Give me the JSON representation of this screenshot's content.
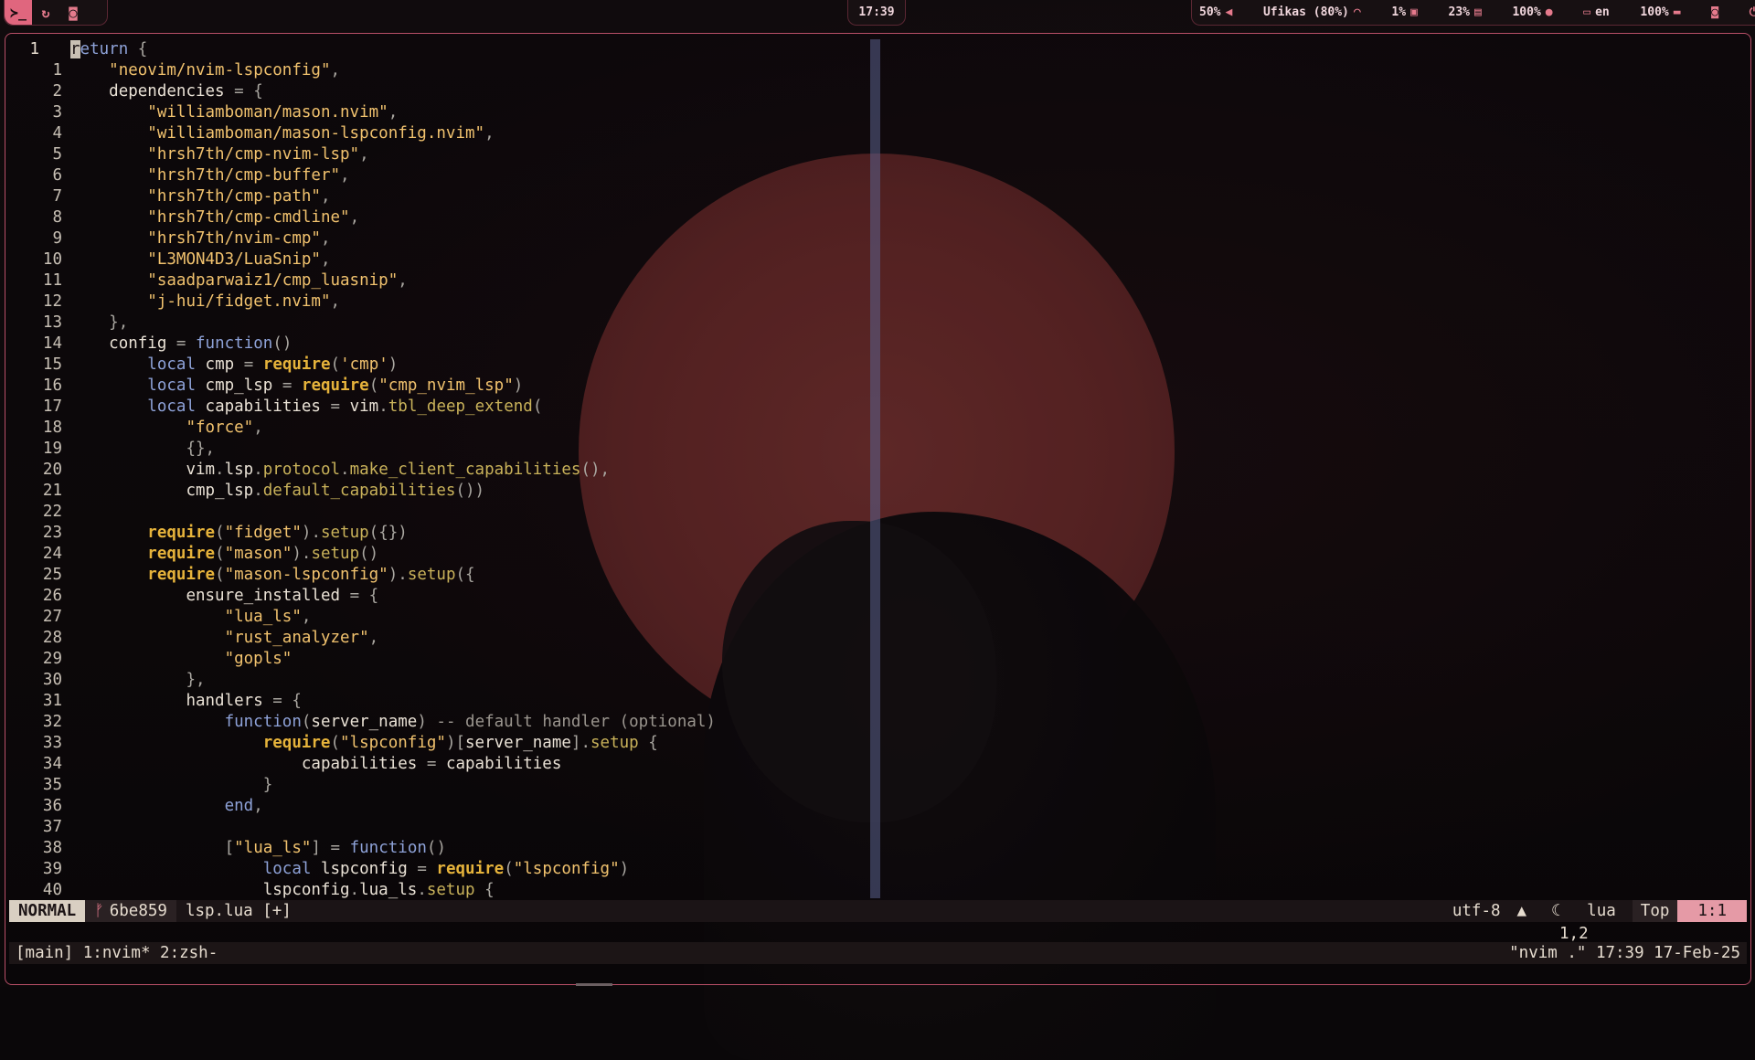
{
  "topbar": {
    "workspaces": [
      {
        "name": "terminal-icon",
        "glyph": "≻_",
        "active": true
      },
      {
        "name": "refresh-icon",
        "glyph": "↻",
        "active": false
      },
      {
        "name": "discord-icon",
        "glyph": "◙",
        "active": false
      }
    ],
    "clock": "17:39",
    "stats": {
      "volume": "50%",
      "wifi": "Ufikas (80%)",
      "cpu": "1%",
      "memory": "23%",
      "brightness": "100%",
      "keyboard_layout": "en",
      "battery": "100%"
    }
  },
  "editor": {
    "first_line_number": "1",
    "lines": [
      {
        "n": "1",
        "html": "<span class=\"cursor-cell\">r</span><span class=\"kw\">eturn</span> <span class=\"pc\">{</span>"
      },
      {
        "n": "1",
        "html": "    <span class=\"str\">\"neovim/nvim-lspconfig\"</span><span class=\"pc\">,</span>"
      },
      {
        "n": "2",
        "html": "    <span class=\"id\">dependencies</span> <span class=\"pc\">=</span> <span class=\"pc\">{</span>"
      },
      {
        "n": "3",
        "html": "        <span class=\"str\">\"williamboman/mason.nvim\"</span><span class=\"pc\">,</span>"
      },
      {
        "n": "4",
        "html": "        <span class=\"str\">\"williamboman/mason-lspconfig.nvim\"</span><span class=\"pc\">,</span>"
      },
      {
        "n": "5",
        "html": "        <span class=\"str\">\"hrsh7th/cmp-nvim-lsp\"</span><span class=\"pc\">,</span>"
      },
      {
        "n": "6",
        "html": "        <span class=\"str\">\"hrsh7th/cmp-buffer\"</span><span class=\"pc\">,</span>"
      },
      {
        "n": "7",
        "html": "        <span class=\"str\">\"hrsh7th/cmp-path\"</span><span class=\"pc\">,</span>"
      },
      {
        "n": "8",
        "html": "        <span class=\"str\">\"hrsh7th/cmp-cmdline\"</span><span class=\"pc\">,</span>"
      },
      {
        "n": "9",
        "html": "        <span class=\"str\">\"hrsh7th/nvim-cmp\"</span><span class=\"pc\">,</span>"
      },
      {
        "n": "10",
        "html": "        <span class=\"str\">\"L3MON4D3/LuaSnip\"</span><span class=\"pc\">,</span>"
      },
      {
        "n": "11",
        "html": "        <span class=\"str\">\"saadparwaiz1/cmp_luasnip\"</span><span class=\"pc\">,</span>"
      },
      {
        "n": "12",
        "html": "        <span class=\"str\">\"j-hui/fidget.nvim\"</span><span class=\"pc\">,</span>"
      },
      {
        "n": "13",
        "html": "    <span class=\"pc\">},</span>"
      },
      {
        "n": "14",
        "html": "    <span class=\"id\">config</span> <span class=\"pc\">=</span> <span class=\"kw\">function</span><span class=\"pc\">()</span>"
      },
      {
        "n": "15",
        "html": "        <span class=\"kw\">local</span> <span class=\"id\">cmp</span> <span class=\"pc\">=</span> <span class=\"fnb\">require</span><span class=\"pc\">(</span><span class=\"str\">'cmp'</span><span class=\"pc\">)</span>"
      },
      {
        "n": "16",
        "html": "        <span class=\"kw\">local</span> <span class=\"id\">cmp_lsp</span> <span class=\"pc\">=</span> <span class=\"fnb\">require</span><span class=\"pc\">(</span><span class=\"str\">\"cmp_nvim_lsp\"</span><span class=\"pc\">)</span>"
      },
      {
        "n": "17",
        "html": "        <span class=\"kw\">local</span> <span class=\"id\">capabilities</span> <span class=\"pc\">=</span> <span class=\"id\">vim</span><span class=\"pc\">.</span><span class=\"fn\">tbl_deep_extend</span><span class=\"pc\">(</span>"
      },
      {
        "n": "18",
        "html": "            <span class=\"str\">\"force\"</span><span class=\"pc\">,</span>"
      },
      {
        "n": "19",
        "html": "            <span class=\"pc\">{},</span>"
      },
      {
        "n": "20",
        "html": "            <span class=\"id\">vim</span><span class=\"pc\">.</span><span class=\"id\">lsp</span><span class=\"pc\">.</span><span class=\"fld\">protocol</span><span class=\"pc\">.</span><span class=\"fn\">make_client_capabilities</span><span class=\"pc\">(),</span>"
      },
      {
        "n": "21",
        "html": "            <span class=\"id\">cmp_lsp</span><span class=\"pc\">.</span><span class=\"fn\">default_capabilities</span><span class=\"pc\">())</span>"
      },
      {
        "n": "22",
        "html": ""
      },
      {
        "n": "23",
        "html": "        <span class=\"fnb\">require</span><span class=\"pc\">(</span><span class=\"str\">\"fidget\"</span><span class=\"pc\">).</span><span class=\"fn\">setup</span><span class=\"pc\">({})</span>"
      },
      {
        "n": "24",
        "html": "        <span class=\"fnb\">require</span><span class=\"pc\">(</span><span class=\"str\">\"mason\"</span><span class=\"pc\">).</span><span class=\"fn\">setup</span><span class=\"pc\">()</span>"
      },
      {
        "n": "25",
        "html": "        <span class=\"fnb\">require</span><span class=\"pc\">(</span><span class=\"str\">\"mason-lspconfig\"</span><span class=\"pc\">).</span><span class=\"fn\">setup</span><span class=\"pc\">({</span>"
      },
      {
        "n": "26",
        "html": "            <span class=\"id\">ensure_installed</span> <span class=\"pc\">=</span> <span class=\"pc\">{</span>"
      },
      {
        "n": "27",
        "html": "                <span class=\"str\">\"lua_ls\"</span><span class=\"pc\">,</span>"
      },
      {
        "n": "28",
        "html": "                <span class=\"str\">\"rust_analyzer\"</span><span class=\"pc\">,</span>"
      },
      {
        "n": "29",
        "html": "                <span class=\"str\">\"gopls\"</span>"
      },
      {
        "n": "30",
        "html": "            <span class=\"pc\">},</span>"
      },
      {
        "n": "31",
        "html": "            <span class=\"id\">handlers</span> <span class=\"pc\">=</span> <span class=\"pc\">{</span>"
      },
      {
        "n": "32",
        "html": "                <span class=\"kw\">function</span><span class=\"pc\">(</span><span class=\"id\">server_name</span><span class=\"pc\">)</span> <span class=\"cm\">-- default handler (optional)</span>"
      },
      {
        "n": "33",
        "html": "                    <span class=\"fnb\">require</span><span class=\"pc\">(</span><span class=\"str\">\"lspconfig\"</span><span class=\"pc\">)[</span><span class=\"id\">server_name</span><span class=\"pc\">].</span><span class=\"fn\">setup</span> <span class=\"pc\">{</span>"
      },
      {
        "n": "34",
        "html": "                        <span class=\"id\">capabilities</span> <span class=\"pc\">=</span> <span class=\"id\">capabilities</span>"
      },
      {
        "n": "35",
        "html": "                    <span class=\"pc\">}</span>"
      },
      {
        "n": "36",
        "html": "                <span class=\"kw\">end</span><span class=\"pc\">,</span>"
      },
      {
        "n": "37",
        "html": ""
      },
      {
        "n": "38",
        "html": "                <span class=\"pc\">[</span><span class=\"str\">\"lua_ls\"</span><span class=\"pc\">]</span> <span class=\"pc\">=</span> <span class=\"kw\">function</span><span class=\"pc\">()</span>"
      },
      {
        "n": "39",
        "html": "                    <span class=\"kw\">local</span> <span class=\"id\">lspconfig</span> <span class=\"pc\">=</span> <span class=\"fnb\">require</span><span class=\"pc\">(</span><span class=\"str\">\"lspconfig\"</span><span class=\"pc\">)</span>"
      },
      {
        "n": "40",
        "html": "                    <span class=\"id\">lspconfig</span><span class=\"pc\">.</span><span class=\"id\">lua_ls</span><span class=\"pc\">.</span><span class=\"fn\">setup</span> <span class=\"pc\">{</span>"
      }
    ]
  },
  "statusline": {
    "mode": "NORMAL",
    "branch_icon": "ᚠ",
    "branch": "6be859",
    "filename": "lsp.lua [+]",
    "encoding": "utf-8",
    "os_icon": "▲",
    "filetype_icon": "☾",
    "filetype": "lua",
    "scroll": "Top",
    "position": "1:1"
  },
  "cmdline": {
    "ruler": "1,2"
  },
  "tmux": {
    "left": "[main] 1:nvim* 2:zsh-",
    "right": "\"nvim .\" 17:39 17-Feb-25"
  }
}
